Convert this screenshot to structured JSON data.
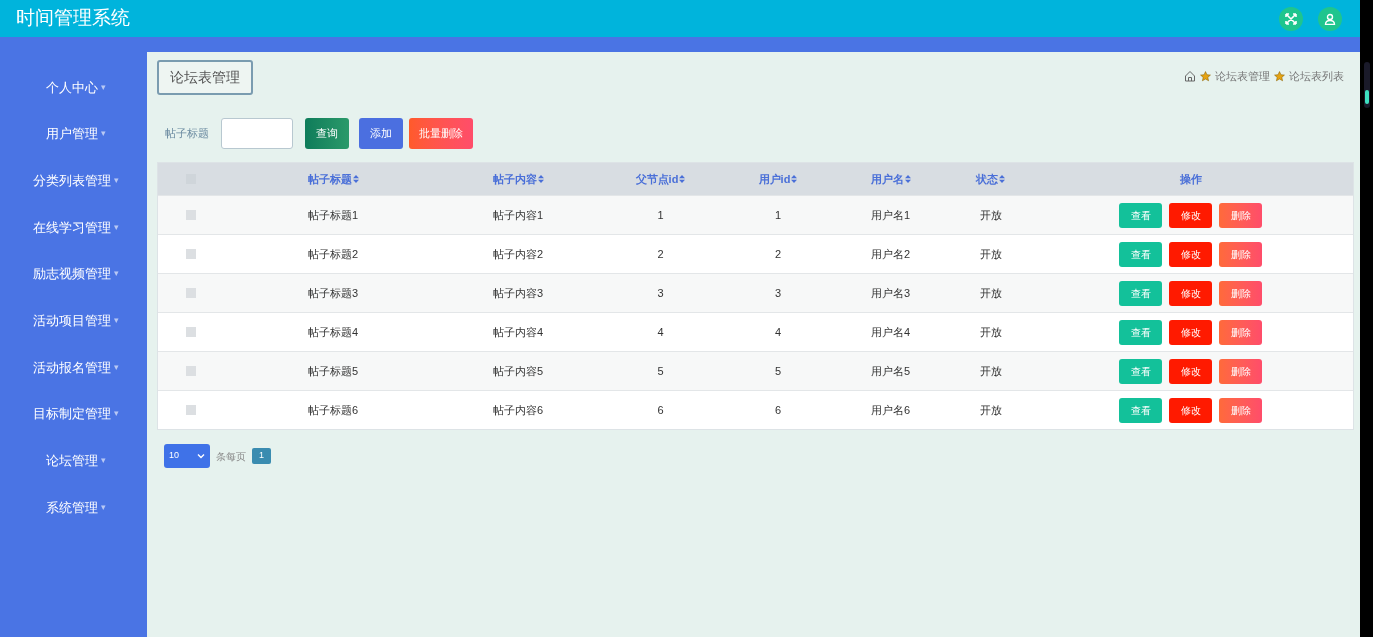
{
  "header": {
    "title": "时间管理系统"
  },
  "sidebar": {
    "items": [
      {
        "label": "个人中心",
        "caret": "▾"
      },
      {
        "label": "用户管理",
        "caret": "▾"
      },
      {
        "label": "分类列表管理",
        "caret": "▾"
      },
      {
        "label": "在线学习管理",
        "caret": "▾"
      },
      {
        "label": "励志视频管理",
        "caret": "▾"
      },
      {
        "label": "活动项目管理",
        "caret": "▾"
      },
      {
        "label": "活动报名管理",
        "caret": "▾"
      },
      {
        "label": "目标制定管理",
        "caret": "▾"
      },
      {
        "label": "论坛管理",
        "caret": "▾"
      },
      {
        "label": "系统管理",
        "caret": "▾"
      }
    ]
  },
  "page_title": "论坛表管理",
  "breadcrumb": [
    "论坛表管理",
    "论坛表列表"
  ],
  "search": {
    "label": "帖子标题",
    "buttons": [
      {
        "label": "查询",
        "kind": "search"
      },
      {
        "label": "添加",
        "kind": "add"
      },
      {
        "label": "批量删除",
        "kind": "delete"
      }
    ]
  },
  "table": {
    "select_all_checked": false,
    "columns": [
      {
        "label": "帖子标题",
        "sortable": true
      },
      {
        "label": "帖子内容",
        "sortable": true
      },
      {
        "label": "父节点id",
        "sortable": true
      },
      {
        "label": "用户id",
        "sortable": true
      },
      {
        "label": "用户名",
        "sortable": true
      },
      {
        "label": "状态",
        "sortable": true
      },
      {
        "label": "操作",
        "sortable": false
      }
    ],
    "rows": [
      {
        "checked": false,
        "cells": [
          "帖子标题1",
          "帖子内容1",
          "1",
          "1",
          "用户名1",
          "开放"
        ],
        "actions": [
          {
            "label": "查看",
            "kind": "view"
          },
          {
            "label": "修改",
            "kind": "edit"
          },
          {
            "label": "删除",
            "kind": "delete"
          }
        ]
      },
      {
        "checked": false,
        "cells": [
          "帖子标题2",
          "帖子内容2",
          "2",
          "2",
          "用户名2",
          "开放"
        ],
        "actions": [
          {
            "label": "查看",
            "kind": "view"
          },
          {
            "label": "修改",
            "kind": "edit"
          },
          {
            "label": "删除",
            "kind": "delete"
          }
        ]
      },
      {
        "checked": false,
        "cells": [
          "帖子标题3",
          "帖子内容3",
          "3",
          "3",
          "用户名3",
          "开放"
        ],
        "actions": [
          {
            "label": "查看",
            "kind": "view"
          },
          {
            "label": "修改",
            "kind": "edit"
          },
          {
            "label": "删除",
            "kind": "delete"
          }
        ]
      },
      {
        "checked": false,
        "cells": [
          "帖子标题4",
          "帖子内容4",
          "4",
          "4",
          "用户名4",
          "开放"
        ],
        "actions": [
          {
            "label": "查看",
            "kind": "view"
          },
          {
            "label": "修改",
            "kind": "edit"
          },
          {
            "label": "删除",
            "kind": "delete"
          }
        ]
      },
      {
        "checked": false,
        "cells": [
          "帖子标题5",
          "帖子内容5",
          "5",
          "5",
          "用户名5",
          "开放"
        ],
        "actions": [
          {
            "label": "查看",
            "kind": "view"
          },
          {
            "label": "修改",
            "kind": "edit"
          },
          {
            "label": "删除",
            "kind": "delete"
          }
        ]
      },
      {
        "checked": false,
        "cells": [
          "帖子标题6",
          "帖子内容6",
          "6",
          "6",
          "用户名6",
          "开放"
        ],
        "actions": [
          {
            "label": "查看",
            "kind": "view"
          },
          {
            "label": "修改",
            "kind": "edit"
          },
          {
            "label": "删除",
            "kind": "delete"
          }
        ]
      }
    ]
  },
  "pagination": {
    "page_size": "10",
    "suffix": "条每页",
    "pages": [
      {
        "label": "1",
        "selected": true
      }
    ]
  }
}
